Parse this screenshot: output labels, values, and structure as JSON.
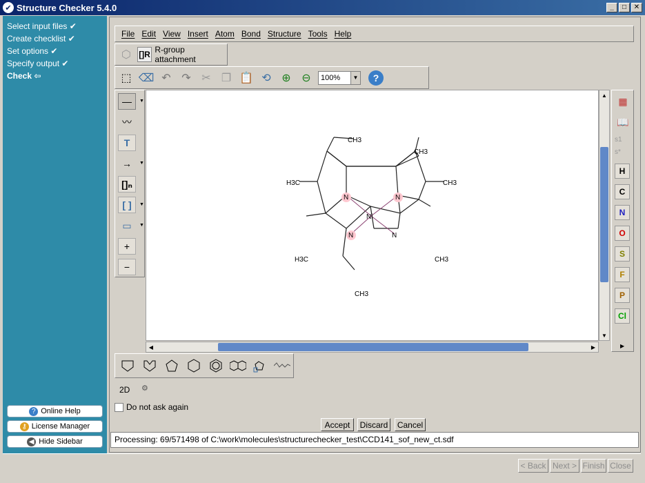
{
  "window": {
    "title": "Structure Checker 5.4.0"
  },
  "sidebar": {
    "steps": [
      {
        "label": "Select input files",
        "mark": "✔"
      },
      {
        "label": "Create checklist",
        "mark": "✔"
      },
      {
        "label": "Set options",
        "mark": "✔"
      },
      {
        "label": "Specify output",
        "mark": "✔"
      },
      {
        "label": "Check",
        "mark": "⇦"
      }
    ],
    "buttons": {
      "online_help": "Online Help",
      "license_manager": "License Manager",
      "hide_sidebar": "Hide Sidebar"
    }
  },
  "menu": [
    "File",
    "Edit",
    "View",
    "Insert",
    "Atom",
    "Bond",
    "Structure",
    "Tools",
    "Help"
  ],
  "rgroup": {
    "label": "R-group attachment",
    "icon_text": "[]R"
  },
  "toolbar": {
    "zoom": "100%",
    "help": "?"
  },
  "elements": [
    "H",
    "C",
    "N",
    "O",
    "S",
    "F",
    "P",
    "Cl"
  ],
  "element_colors": {
    "H": "#000000",
    "C": "#000000",
    "N": "#2020c0",
    "O": "#d00000",
    "S": "#808000",
    "F": "#b08000",
    "P": "#a06000",
    "Cl": "#00a000"
  },
  "side_labels": {
    "s1": "s1",
    "sstar": "s*"
  },
  "molecule": {
    "labels": {
      "ch3": "CH3",
      "h3c": "H3C",
      "ni": "Ni",
      "n": "N"
    }
  },
  "mode": "2D",
  "checkbox": {
    "label": "Do not ask again"
  },
  "dialog_buttons": {
    "accept": "Accept",
    "discard": "Discard",
    "cancel": "Cancel"
  },
  "status": "Processing: 69/571498 of C:\\work\\molecules\\structurechecker_test\\CCD141_sof_new_ct.sdf",
  "nav": {
    "back": "< Back",
    "next": "Next >",
    "finish": "Finish",
    "close": "Close"
  }
}
